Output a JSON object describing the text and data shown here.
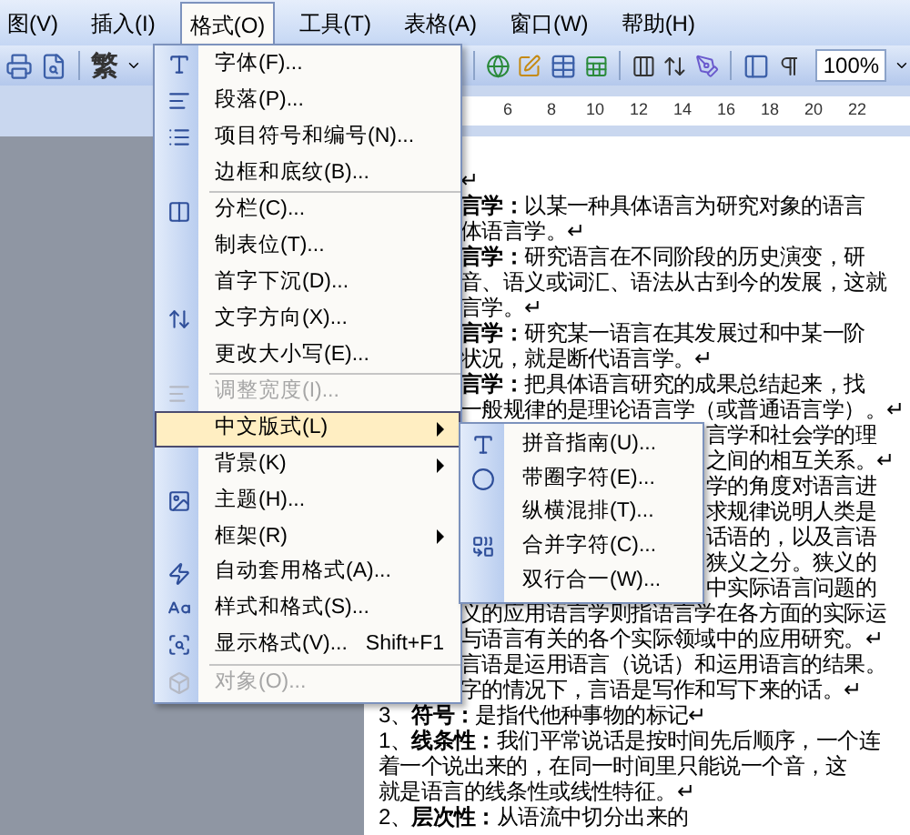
{
  "menu_bar": {
    "items": [
      {
        "label": "图(V)",
        "selected": false
      },
      {
        "label": "插入(I)",
        "selected": false
      },
      {
        "label": "格式(O)",
        "selected": true
      },
      {
        "label": "工具(T)",
        "selected": false
      },
      {
        "label": "表格(A)",
        "selected": false
      },
      {
        "label": "窗口(W)",
        "selected": false
      },
      {
        "label": "帮助(H)",
        "selected": false
      }
    ]
  },
  "toolbar": {
    "font_char": "繁",
    "zoom": "100%"
  },
  "ruler": {
    "numbers": [
      "6",
      "8",
      "10",
      "12",
      "14",
      "16",
      "18",
      "20",
      "22"
    ]
  },
  "format_menu": {
    "groups": [
      [
        {
          "label": "字体(F)...",
          "selected": false,
          "disabled": false,
          "submenu": false
        },
        {
          "label": "段落(P)...",
          "selected": false,
          "disabled": false,
          "submenu": false
        },
        {
          "label": "项目符号和编号(N)...",
          "selected": false,
          "disabled": false,
          "submenu": false
        },
        {
          "label": "边框和底纹(B)...",
          "selected": false,
          "disabled": false,
          "submenu": false
        }
      ],
      [
        {
          "label": "分栏(C)...",
          "selected": false,
          "disabled": false,
          "submenu": false
        },
        {
          "label": "制表位(T)...",
          "selected": false,
          "disabled": false,
          "submenu": false
        },
        {
          "label": "首字下沉(D)...",
          "selected": false,
          "disabled": false,
          "submenu": false
        },
        {
          "label": "文字方向(X)...",
          "selected": false,
          "disabled": false,
          "submenu": false
        },
        {
          "label": "更改大小写(E)...",
          "selected": false,
          "disabled": false,
          "submenu": false
        }
      ],
      [
        {
          "label": "调整宽度(I)...",
          "selected": false,
          "disabled": true,
          "submenu": false
        },
        {
          "label": "中文版式(L)",
          "selected": true,
          "disabled": false,
          "submenu": true
        },
        {
          "label": "背景(K)",
          "selected": false,
          "disabled": false,
          "submenu": true
        },
        {
          "label": "主题(H)...",
          "selected": false,
          "disabled": false,
          "submenu": false
        },
        {
          "label": "框架(R)",
          "selected": false,
          "disabled": false,
          "submenu": true
        },
        {
          "label": "自动套用格式(A)...",
          "selected": false,
          "disabled": false,
          "submenu": false
        },
        {
          "label": "样式和格式(S)...",
          "selected": false,
          "disabled": false,
          "submenu": false
        },
        {
          "label": "显示格式(V)...",
          "shortcut": "Shift+F1",
          "selected": false,
          "disabled": false,
          "submenu": false
        }
      ],
      [
        {
          "label": "对象(O)...",
          "selected": false,
          "disabled": true,
          "submenu": false
        }
      ]
    ]
  },
  "submenu": {
    "items": [
      {
        "label": "拼音指南(U)..."
      },
      {
        "label": "带圈字符(E)..."
      },
      {
        "label": "纵横混排(T)..."
      },
      {
        "label": "合并字符(C)..."
      },
      {
        "label": "双行合一(W)..."
      }
    ]
  },
  "document": {
    "lines": [
      {
        "text": "↵",
        "kind": "beside_menu"
      },
      {
        "text": "**言学：**以某一种具体语言为研究对象的语言",
        "kind": "beside_menu"
      },
      {
        "text": "体语言学。↵",
        "kind": "beside_menu"
      },
      {
        "text": "**言学：**研究语言在不同阶段的历史演变，研",
        "kind": "beside_menu"
      },
      {
        "text": "音、语义或词汇、语法从古到今的发展，这就",
        "kind": "beside_menu"
      },
      {
        "text": "言学。↵",
        "kind": "beside_menu"
      },
      {
        "text": "**言学：**研究某一语言在其发展过和中某一阶",
        "kind": "beside_menu"
      },
      {
        "text": "状况，就是断代语言学。↵",
        "kind": "beside_menu"
      },
      {
        "text": "**言学：**把具体语言研究的成果总结起来，找",
        "kind": "beside_menu"
      },
      {
        "text": "一般规律的是理论语言学（或普通语言学）。↵",
        "kind": "beside_menu"
      },
      {
        "text": "言学和社会学的理",
        "kind": "beside_submenu"
      },
      {
        "text": "之间的相互关系。↵",
        "kind": "beside_submenu"
      },
      {
        "text": "学的角度对语言进",
        "kind": "beside_submenu"
      },
      {
        "text": "求规律说明人类是",
        "kind": "beside_submenu"
      },
      {
        "text": "话语的，以及言语",
        "kind": "beside_submenu"
      },
      {
        "text": "狭义之分。狭义的",
        "kind": "beside_submenu"
      },
      {
        "text": "中实际语言问题的",
        "kind": "beside_submenu"
      },
      {
        "text": "义的应用语言学则指语言学在各方面的实际运",
        "kind": "beside_menu"
      },
      {
        "text": "与语言有关的各个实际领域中的应用研究。↵",
        "kind": "beside_menu"
      },
      {
        "text": "言语是运用语言（说话）和运用语言的结果。",
        "kind": "beside_menu"
      },
      {
        "text": "字的情况下，言语是写作和写下来的话。↵",
        "kind": "beside_menu"
      },
      {
        "text": "3、**符号：**是指代他种事物的标记↵",
        "kind": "full"
      },
      {
        "text": "1、**线条性：**我们平常说话是按时间先后顺序，一个连",
        "kind": "full"
      },
      {
        "text": "着一个说出来的，在同一时间里只能说一个音，这",
        "kind": "full"
      },
      {
        "text": "就是语言的线条性或线性特征。↵",
        "kind": "full"
      },
      {
        "text": "2、**层次性：**从语流中切分出来的",
        "kind": "full"
      }
    ]
  }
}
